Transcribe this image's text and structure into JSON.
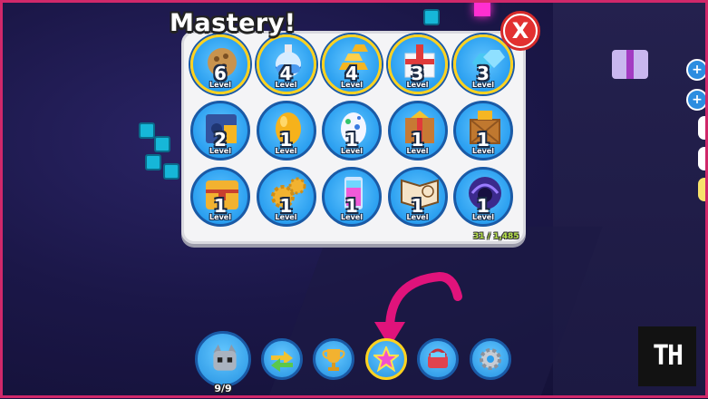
{
  "panel": {
    "title": "Mastery!",
    "close_label": "X"
  },
  "mastery_items": [
    {
      "icon": "pet-food-bag-icon",
      "level": "6",
      "label": "Level"
    },
    {
      "icon": "potion-icon",
      "level": "4",
      "label": "Level"
    },
    {
      "icon": "gold-bars-icon",
      "level": "4",
      "label": "Level"
    },
    {
      "icon": "gift-box-icon",
      "level": "3",
      "label": "Level"
    },
    {
      "icon": "diamond-gems-icon",
      "level": "3",
      "label": "Level"
    },
    {
      "icon": "vault-icon",
      "level": "2",
      "label": "Level"
    },
    {
      "icon": "golden-egg-icon",
      "level": "1",
      "label": "Level"
    },
    {
      "icon": "spotted-egg-icon",
      "level": "1",
      "label": "Level"
    },
    {
      "icon": "crate-icon",
      "level": "1",
      "label": "Level"
    },
    {
      "icon": "coin-crate-icon",
      "level": "1",
      "label": "Level"
    },
    {
      "icon": "treasure-chest-icon",
      "level": "1",
      "label": "Level"
    },
    {
      "icon": "gears-icon",
      "level": "1",
      "label": "Level"
    },
    {
      "icon": "lava-lamp-icon",
      "level": "1",
      "label": "Level"
    },
    {
      "icon": "spellbook-icon",
      "level": "1",
      "label": "Level"
    },
    {
      "icon": "void-cat-icon",
      "level": "1",
      "label": "Level"
    }
  ],
  "progress_text": "31 / 1,485",
  "hotbar": {
    "pet_count": "9/9",
    "buttons": [
      {
        "icon": "trade-arrows-icon"
      },
      {
        "icon": "trophy-icon"
      },
      {
        "icon": "mastery-star-icon",
        "active": true
      },
      {
        "icon": "shop-basket-icon"
      },
      {
        "icon": "settings-gear-icon"
      }
    ]
  },
  "watermark": "TH",
  "colors": {
    "accent": "#e0137b",
    "button_blue": "#2a9ff0",
    "close_red": "#e23030",
    "progress_green": "#b8e34a"
  }
}
